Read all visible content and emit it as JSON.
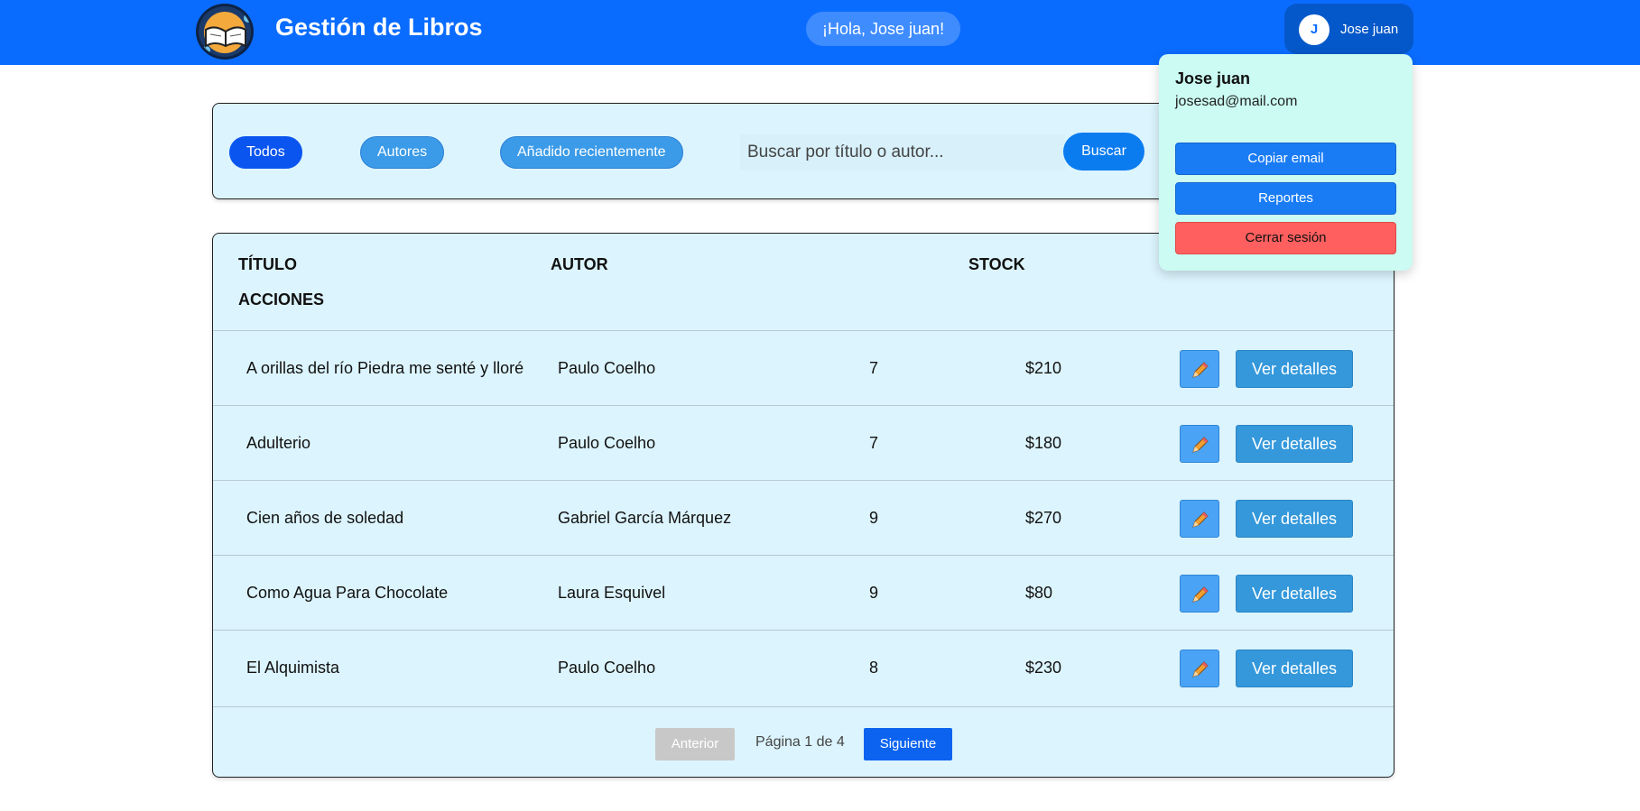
{
  "header": {
    "app_title": "Gestión de Libros",
    "greeting": "¡Hola, Jose juan!",
    "user": {
      "initial": "J",
      "name": "Jose juan"
    }
  },
  "filters": {
    "chips": [
      {
        "label": "Todos",
        "active": true
      },
      {
        "label": "Autores",
        "active": false
      },
      {
        "label": "Añadido recientemente",
        "active": false
      }
    ],
    "search_placeholder": "Buscar por título o autor...",
    "search_button": "Buscar"
  },
  "table": {
    "headers": {
      "title": "TÍTULO",
      "author": "AUTOR",
      "stock": "STOCK",
      "actions": "ACCIONES"
    },
    "rows": [
      {
        "title": "A orillas del río Piedra me senté y lloré",
        "author": "Paulo Coelho",
        "stock": "7",
        "price": "$210",
        "details": "Ver detalles"
      },
      {
        "title": "Adulterio",
        "author": "Paulo Coelho",
        "stock": "7",
        "price": "$180",
        "details": "Ver detalles"
      },
      {
        "title": "Cien años de soledad",
        "author": "Gabriel García Márquez",
        "stock": "9",
        "price": "$270",
        "details": "Ver detalles"
      },
      {
        "title": "Como Agua Para Chocolate",
        "author": "Laura Esquivel",
        "stock": "9",
        "price": "$80",
        "details": "Ver detalles"
      },
      {
        "title": "El Alquimista",
        "author": "Paulo Coelho",
        "stock": "8",
        "price": "$230",
        "details": "Ver detalles"
      }
    ],
    "edit_icon": "pencil-icon"
  },
  "pagination": {
    "prev": "Anterior",
    "info": "Página 1 de 4",
    "next": "Siguiente"
  },
  "user_menu": {
    "name": "Jose juan",
    "email": "josesad@mail.com",
    "copy_email": "Copiar email",
    "reports": "Reportes",
    "logout": "Cerrar sesión"
  },
  "colors": {
    "header": "#0a6cff",
    "panel": "#dcf4fd",
    "dropdown": "#cbfbf2",
    "logout": "#ff5f5f",
    "primary": "#0b7cf0"
  }
}
